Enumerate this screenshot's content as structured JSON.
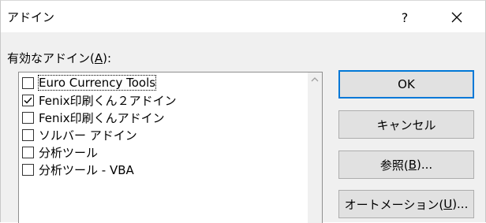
{
  "window": {
    "title": "アドイン",
    "help_label": "?",
    "close_icon": "close-icon"
  },
  "addins": {
    "label_prefix": "有効なアドイン(",
    "label_accel": "A",
    "label_suffix": "):",
    "items": [
      {
        "label": "Euro Currency Tools",
        "checked": false
      },
      {
        "label": "Fenix印刷くん２アドイン",
        "checked": true
      },
      {
        "label": "Fenix印刷くんアドイン",
        "checked": false
      },
      {
        "label": "ソルバー アドイン",
        "checked": false
      },
      {
        "label": "分析ツール",
        "checked": false
      },
      {
        "label": "分析ツール - VBA",
        "checked": false
      }
    ]
  },
  "buttons": {
    "ok": "OK",
    "cancel": "キャンセル",
    "browse_prefix": "参照(",
    "browse_accel": "B",
    "browse_suffix": ")...",
    "automation_prefix": "オートメーション(",
    "automation_accel": "U",
    "automation_suffix": ")..."
  }
}
